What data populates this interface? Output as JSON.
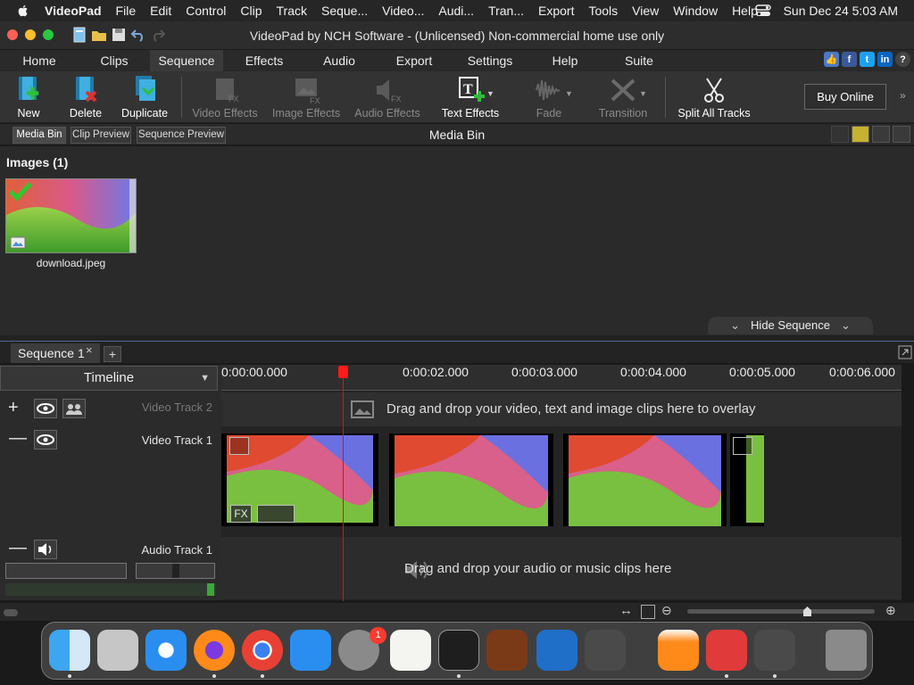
{
  "menubar": {
    "app_name": "VideoPad",
    "items": [
      "File",
      "Edit",
      "Control",
      "Clip",
      "Track",
      "Seque...",
      "Video...",
      "Audi...",
      "Tran...",
      "Export",
      "Tools",
      "View",
      "Window",
      "Help"
    ],
    "datetime": "Sun Dec 24  5:03 AM"
  },
  "window": {
    "title": "VideoPad by NCH Software - (Unlicensed) Non-commercial home use only"
  },
  "nav_tabs": [
    "Home",
    "Clips",
    "Sequence",
    "Effects",
    "Audio",
    "Export",
    "Settings",
    "Help",
    "Suite"
  ],
  "nav_active": "Sequence",
  "toolbar": {
    "new": "New",
    "delete": "Delete",
    "duplicate": "Duplicate",
    "video_effects": "Video Effects",
    "image_effects": "Image Effects",
    "audio_effects": "Audio Effects",
    "text_effects": "Text Effects",
    "fade": "Fade",
    "transition": "Transition",
    "split_all_tracks": "Split All Tracks",
    "buy_online": "Buy Online"
  },
  "panel": {
    "tabs": [
      "Media Bin",
      "Clip Preview",
      "Sequence Preview"
    ],
    "title": "Media Bin",
    "images_header": "Images (1)",
    "file_name": "download.jpeg",
    "hide_sequence": "Hide Sequence"
  },
  "sequence": {
    "tab": "Sequence 1",
    "close": "×",
    "add": "+",
    "timeline_label": "Timeline",
    "ruler_ticks": [
      "0:00:00.000",
      "0:00:02.000",
      "0:00:03.000",
      "0:00:04.000",
      "0:00:05.000",
      "0:00:06.000"
    ],
    "video_track_2": "Video Track 2",
    "video_track_1": "Video Track 1",
    "audio_track_1": "Audio Track 1",
    "overlay_hint": "Drag and drop your video, text and image clips here to overlay",
    "audio_hint": "Drag and drop your audio or music clips here",
    "fx_label": "FX"
  },
  "dock": {
    "settings_badge": "1"
  },
  "colors": {
    "accent_red": "#ff1b1b",
    "toolbar_bg": "#333333",
    "bin_bg": "#2a2a2a"
  }
}
